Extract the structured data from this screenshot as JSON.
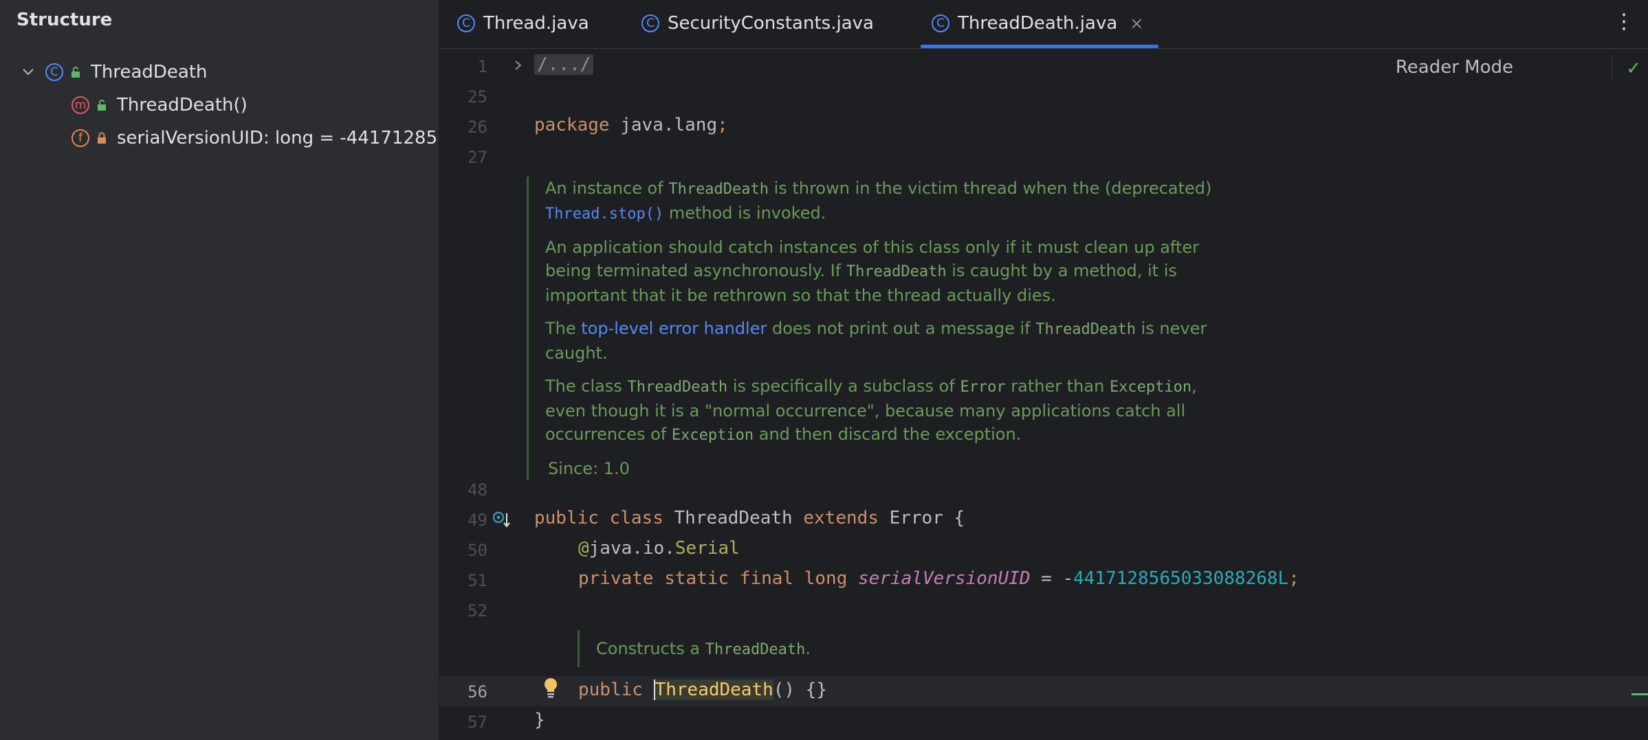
{
  "structure": {
    "title": "Structure",
    "items": [
      {
        "label": "ThreadDeath",
        "icon": "class-icon"
      },
      {
        "label": "ThreadDeath()",
        "icon": "method-icon"
      },
      {
        "label": "serialVersionUID: long = -4417128565",
        "icon": "field-icon"
      }
    ]
  },
  "tabs": [
    {
      "label": "Thread.java",
      "icon": "class-icon"
    },
    {
      "label": "SecurityConstants.java",
      "icon": "class-icon"
    },
    {
      "label": "ThreadDeath.java",
      "icon": "class-icon",
      "active": true,
      "close": "×"
    }
  ],
  "editor": {
    "reader_mode": "Reader Mode",
    "line_numbers": [
      "1",
      "25",
      "26",
      "27",
      "48",
      "49",
      "50",
      "51",
      "52",
      "56",
      "57"
    ],
    "folded": "/.../",
    "package_kw": "package",
    "package_name": " java.lang",
    "semicolon": ";",
    "doc": {
      "p1_a": "An instance of ",
      "p1_code": "ThreadDeath",
      "p1_b": " is thrown in the victim thread when the (deprecated) ",
      "p1_link": "Thread.stop()",
      "p1_c": " method is invoked.",
      "p2_a": "An application should catch instances of this class only if it must clean up after being terminated asynchronously. If ",
      "p2_code": "ThreadDeath",
      "p2_b": " is caught by a method, it is important that it be rethrown so that the thread actually dies.",
      "p3_a": "The ",
      "p3_link": "top-level error handler",
      "p3_b": " does not print out a message if ",
      "p3_code": "ThreadDeath",
      "p3_c": " is never caught.",
      "p4_a": "The class ",
      "p4_code1": "ThreadDeath",
      "p4_b": " is specifically a subclass of ",
      "p4_code2": "Error",
      "p4_c": " rather than ",
      "p4_code3": "Exception",
      "p4_d": ", even though it is a \"normal occurrence\", because many applications catch all occurrences of ",
      "p4_code4": "Exception",
      "p4_e": " and then discard the exception.",
      "since": "Since:  1.0"
    },
    "class_line": {
      "kw1": "public",
      "kw2": "class",
      "name": "ThreadDeath",
      "kw3": "extends",
      "parent": "Error",
      "brace": " {"
    },
    "annotation_at": "@",
    "annotation_pkg": "java.io.",
    "annotation_name": "Serial",
    "field_line": {
      "kw1": "private",
      "kw2": "static",
      "kw3": "final",
      "kw4": "long",
      "name": "serialVersionUID",
      "eq": " = -",
      "value": "4417128565033088268L",
      "semi": ";"
    },
    "doc2_a": "Constructs a ",
    "doc2_code": "ThreadDeath",
    "doc2_b": ".",
    "ctor_line": {
      "kw": "public",
      "name": "ThreadDeath",
      "rest": "() {}"
    },
    "close_brace": "}"
  }
}
